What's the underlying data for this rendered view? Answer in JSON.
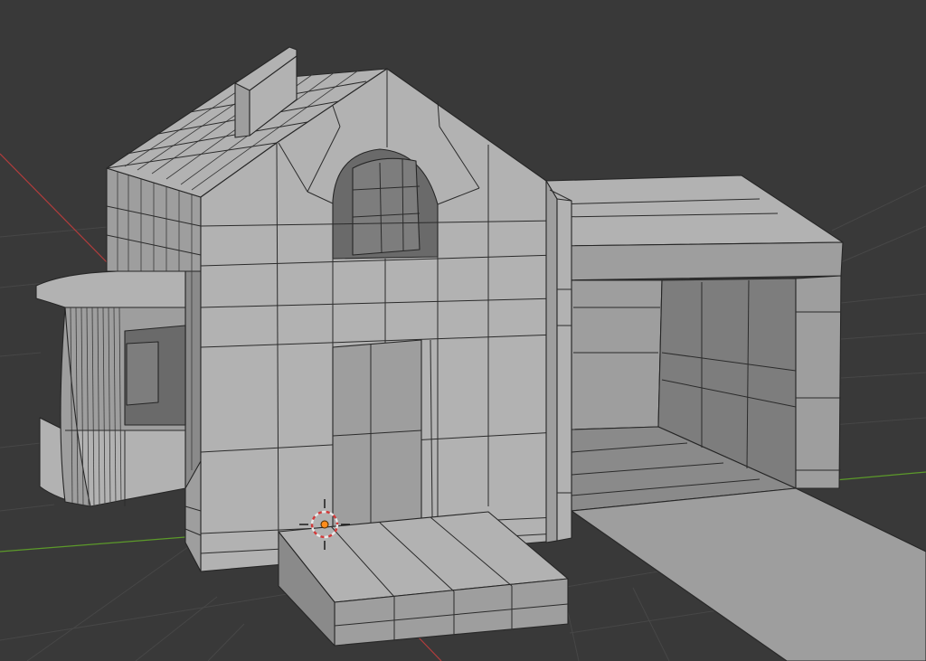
{
  "viewport": {
    "background_color": "#393939",
    "grid_color": "#474747",
    "axis_x_color": "#b23c3c",
    "axis_y_color": "#5c9a2a",
    "mesh_color": "#a3a3a3",
    "wire_color": "#262626"
  },
  "scene_object": {
    "type": "house-mesh"
  },
  "cursor_3d": {
    "icon": "3d-cursor-icon",
    "ring_colors": [
      "#e8e8e8",
      "#d33a3a"
    ],
    "center_color": "#ff8c1a"
  }
}
